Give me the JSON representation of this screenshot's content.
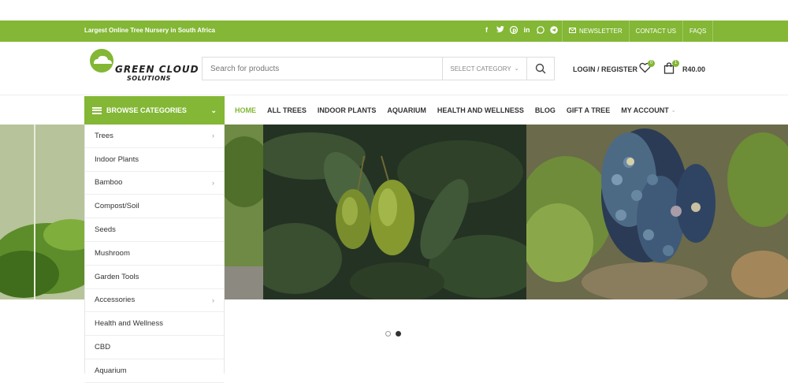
{
  "topbar": {
    "tagline": "Largest Online Tree Nursery in South Africa",
    "social_icons": [
      "facebook-icon",
      "twitter-icon",
      "pinterest-icon",
      "linkedin-icon",
      "whatsapp-icon",
      "telegram-icon"
    ],
    "newsletter": "NEWSLETTER",
    "contact": "CONTACT US",
    "faqs": "FAQS"
  },
  "logo": {
    "line1": "GREEN CLOUD",
    "line2": "SOLUTIONS"
  },
  "search": {
    "placeholder": "Search for products",
    "category": "SELECT CATEGORY"
  },
  "account": {
    "login": "LOGIN / REGISTER",
    "wishlist_count": "0",
    "cart_count": "1",
    "cart_total": "R40.00"
  },
  "browse": {
    "label": "BROWSE CATEGORIES"
  },
  "menu": {
    "items": [
      "HOME",
      "ALL TREES",
      "INDOOR PLANTS",
      "AQUARIUM",
      "HEALTH AND WELLNESS",
      "BLOG",
      "GIFT A TREE",
      "MY ACCOUNT"
    ]
  },
  "categories": [
    {
      "label": "Trees",
      "has_sub": true
    },
    {
      "label": "Indoor Plants",
      "has_sub": false
    },
    {
      "label": "Bamboo",
      "has_sub": true
    },
    {
      "label": "Compost/Soil",
      "has_sub": false
    },
    {
      "label": "Seeds",
      "has_sub": false
    },
    {
      "label": "Mushroom",
      "has_sub": false
    },
    {
      "label": "Garden Tools",
      "has_sub": false
    },
    {
      "label": "Accessories",
      "has_sub": true
    },
    {
      "label": "Health and Wellness",
      "has_sub": false
    },
    {
      "label": "CBD",
      "has_sub": false
    },
    {
      "label": "Aquarium",
      "has_sub": false
    }
  ],
  "colors": {
    "accent": "#83b735"
  }
}
